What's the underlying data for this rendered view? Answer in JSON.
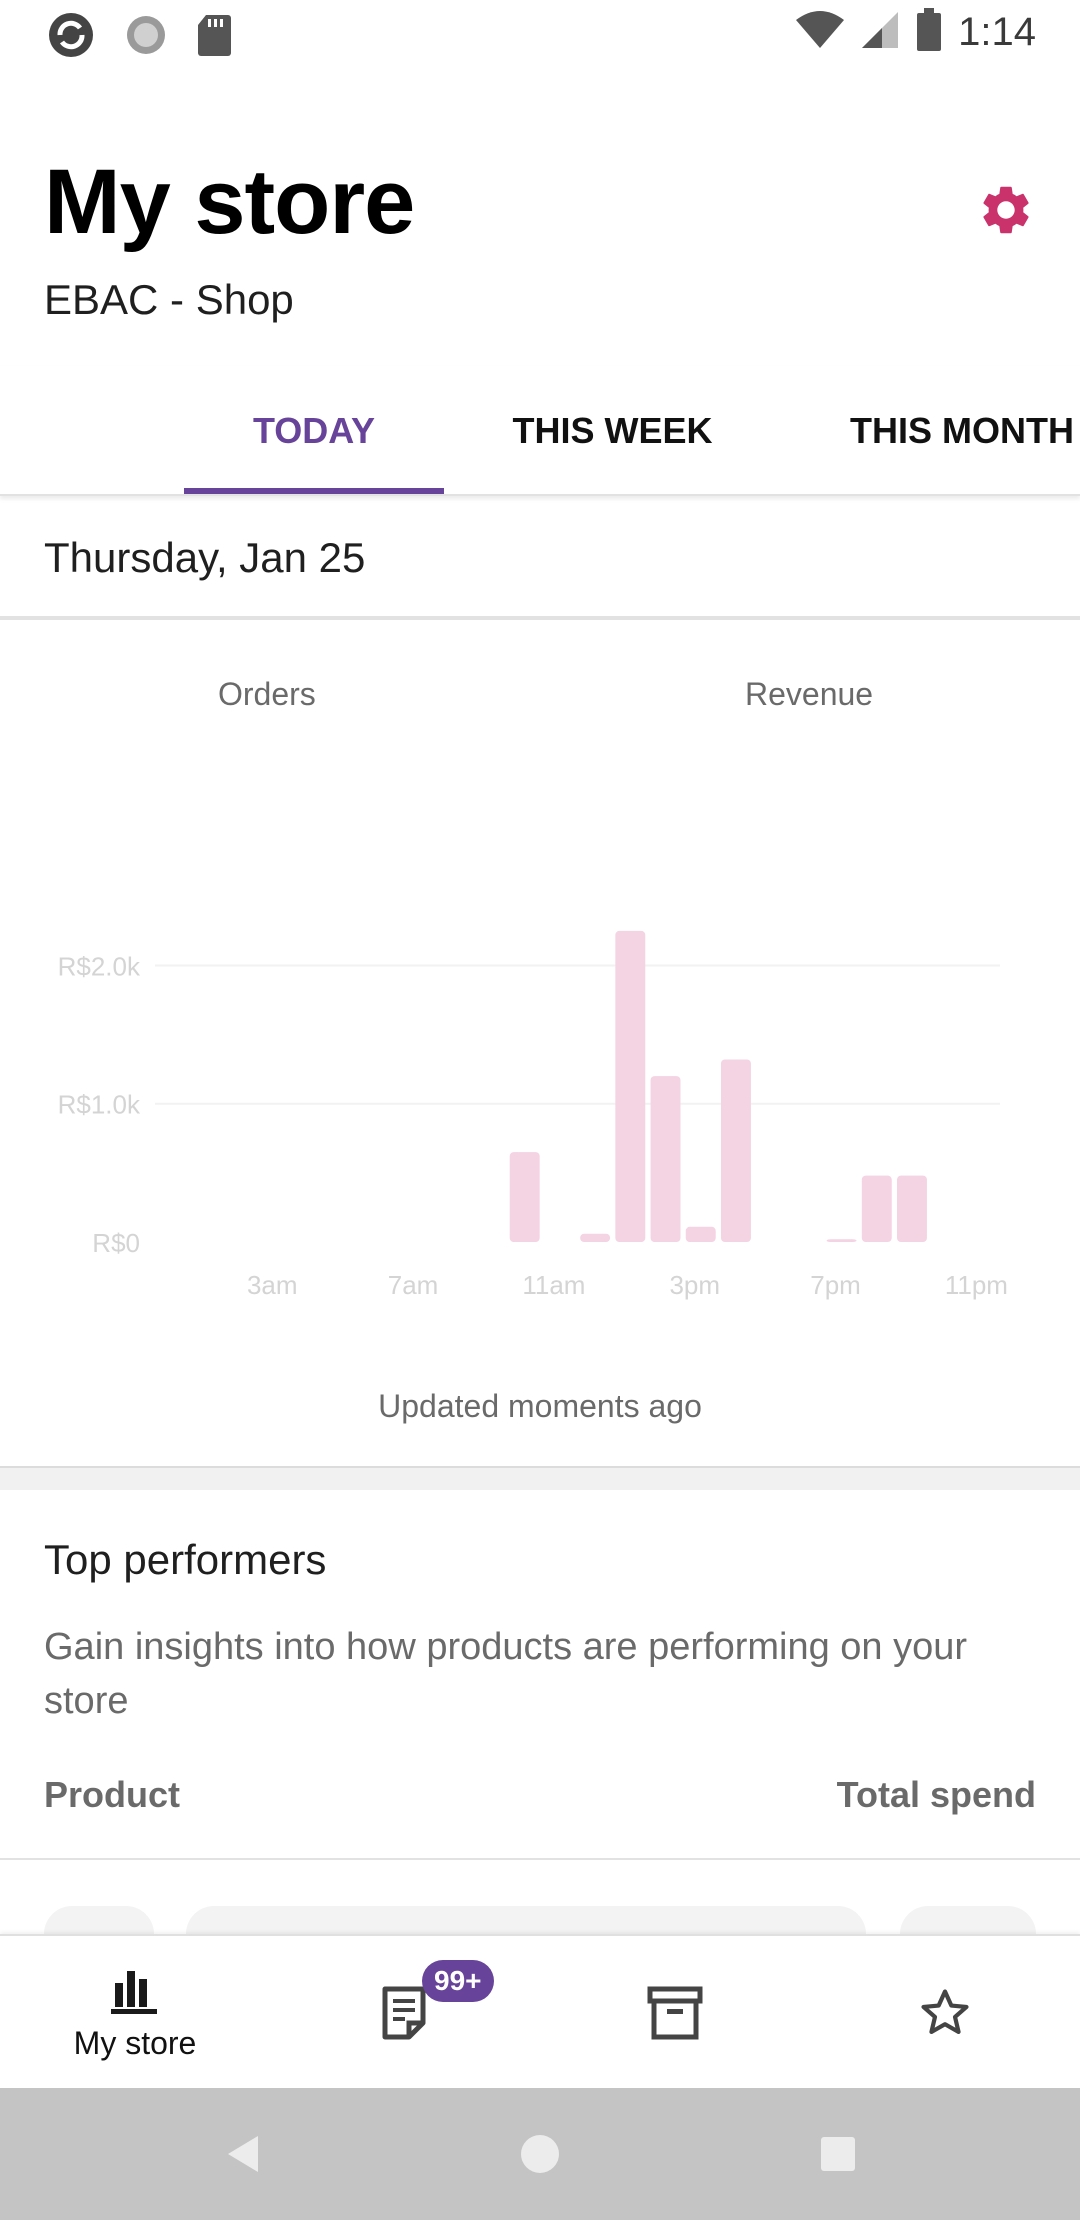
{
  "status_bar": {
    "time": "1:14"
  },
  "header": {
    "title": "My store",
    "store_name": "EBAC - Shop"
  },
  "tabs": [
    {
      "label": "TODAY",
      "active": true
    },
    {
      "label": "THIS WEEK",
      "active": false
    },
    {
      "label": "THIS MONTH",
      "active": false
    }
  ],
  "date": "Thursday, Jan 25",
  "stats": {
    "orders_label": "Orders",
    "revenue_label": "Revenue",
    "updated_text": "Updated moments ago"
  },
  "chart_data": {
    "type": "bar",
    "x": [
      "0",
      "1",
      "2",
      "3",
      "4",
      "5",
      "6",
      "7",
      "8",
      "9",
      "10",
      "11",
      "12",
      "13",
      "14",
      "15",
      "16",
      "17",
      "18",
      "19",
      "20",
      "21",
      "22",
      "23"
    ],
    "xticks": [
      "3am",
      "7am",
      "11am",
      "3pm",
      "7pm",
      "11pm"
    ],
    "xtick_index": [
      3,
      7,
      11,
      15,
      19,
      23
    ],
    "values": [
      0,
      0,
      0,
      0,
      0,
      0,
      0,
      0,
      0,
      0,
      650,
      0,
      60,
      2250,
      1200,
      110,
      1320,
      0,
      0,
      20,
      480,
      480,
      0,
      0
    ],
    "yticks": [
      "R$0",
      "R$1.0k",
      "R$2.0k"
    ],
    "ytick_values": [
      0,
      1000,
      2000
    ],
    "ylim": [
      0,
      2300
    ],
    "bar_color": "#f4d3e2",
    "grid": true
  },
  "top_performers": {
    "title": "Top performers",
    "description": "Gain insights into how products are performing on your store",
    "col_product": "Product",
    "col_total_spend": "Total spend"
  },
  "bottom_nav": {
    "my_store_label": "My store",
    "orders_badge": "99+"
  },
  "colors": {
    "accent": "#674399",
    "settings_icon": "#c9326b"
  }
}
